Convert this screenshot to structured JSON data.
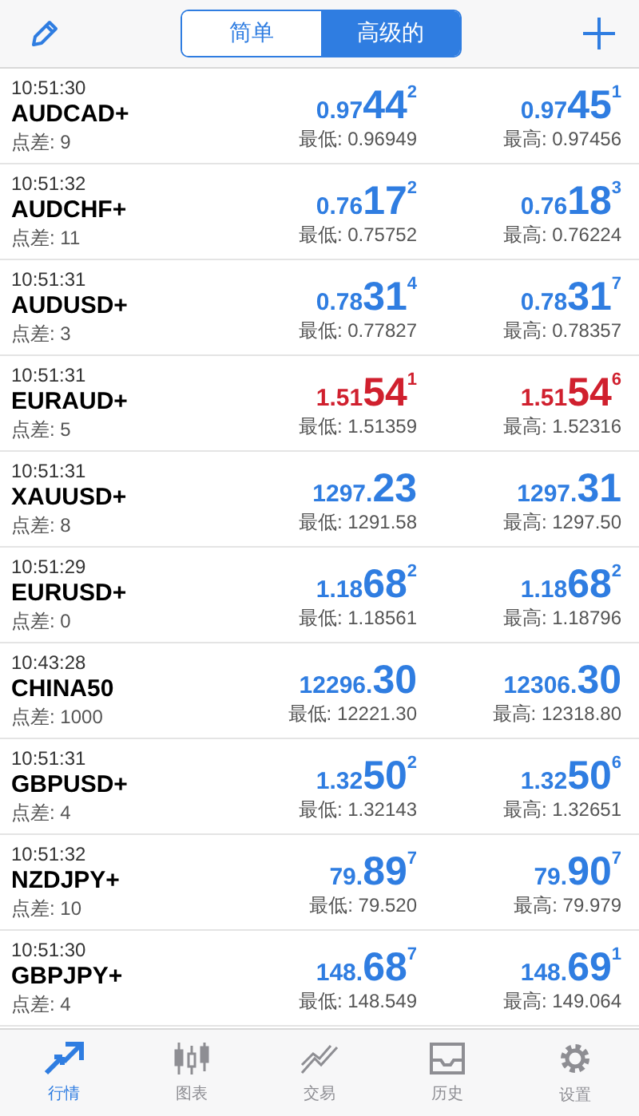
{
  "header": {
    "segments": [
      {
        "label": "简单",
        "selected": false
      },
      {
        "label": "高级的",
        "selected": true
      }
    ]
  },
  "quotes": [
    {
      "time": "10:51:30",
      "symbol": "AUDCAD+",
      "spread": "点差: 9",
      "bid": {
        "color": "#2f7de1",
        "small": "0.97",
        "big": "44",
        "sup": "2"
      },
      "ask": {
        "color": "#2f7de1",
        "small": "0.97",
        "big": "45",
        "sup": "1"
      },
      "low": "最低: 0.96949",
      "high": "最高: 0.97456"
    },
    {
      "time": "10:51:32",
      "symbol": "AUDCHF+",
      "spread": "点差: 11",
      "bid": {
        "color": "#2f7de1",
        "small": "0.76",
        "big": "17",
        "sup": "2"
      },
      "ask": {
        "color": "#2f7de1",
        "small": "0.76",
        "big": "18",
        "sup": "3"
      },
      "low": "最低: 0.75752",
      "high": "最高: 0.76224"
    },
    {
      "time": "10:51:31",
      "symbol": "AUDUSD+",
      "spread": "点差: 3",
      "bid": {
        "color": "#2f7de1",
        "small": "0.78",
        "big": "31",
        "sup": "4"
      },
      "ask": {
        "color": "#2f7de1",
        "small": "0.78",
        "big": "31",
        "sup": "7"
      },
      "low": "最低: 0.77827",
      "high": "最高: 0.78357"
    },
    {
      "time": "10:51:31",
      "symbol": "EURAUD+",
      "spread": "点差: 5",
      "bid": {
        "color": "#d0202e",
        "small": "1.51",
        "big": "54",
        "sup": "1"
      },
      "ask": {
        "color": "#d0202e",
        "small": "1.51",
        "big": "54",
        "sup": "6"
      },
      "low": "最低: 1.51359",
      "high": "最高: 1.52316"
    },
    {
      "time": "10:51:31",
      "symbol": "XAUUSD+",
      "spread": "点差: 8",
      "bid": {
        "color": "#2f7de1",
        "small": "1297.",
        "big": "23"
      },
      "ask": {
        "color": "#2f7de1",
        "small": "1297.",
        "big": "31"
      },
      "low": "最低: 1291.58",
      "high": "最高: 1297.50"
    },
    {
      "time": "10:51:29",
      "symbol": "EURUSD+",
      "spread": "点差: 0",
      "bid": {
        "color": "#2f7de1",
        "small": "1.18",
        "big": "68",
        "sup": "2"
      },
      "ask": {
        "color": "#2f7de1",
        "small": "1.18",
        "big": "68",
        "sup": "2"
      },
      "low": "最低: 1.18561",
      "high": "最高: 1.18796"
    },
    {
      "time": "10:43:28",
      "symbol": "CHINA50",
      "spread": "点差: 1000",
      "bid": {
        "color": "#2f7de1",
        "small": "12296.",
        "big": "30"
      },
      "ask": {
        "color": "#2f7de1",
        "small": "12306.",
        "big": "30"
      },
      "low": "最低: 12221.30",
      "high": "最高: 12318.80"
    },
    {
      "time": "10:51:31",
      "symbol": "GBPUSD+",
      "spread": "点差: 4",
      "bid": {
        "color": "#2f7de1",
        "small": "1.32",
        "big": "50",
        "sup": "2"
      },
      "ask": {
        "color": "#2f7de1",
        "small": "1.32",
        "big": "50",
        "sup": "6"
      },
      "low": "最低: 1.32143",
      "high": "最高: 1.32651"
    },
    {
      "time": "10:51:32",
      "symbol": "NZDJPY+",
      "spread": "点差: 10",
      "bid": {
        "color": "#2f7de1",
        "small": "79.",
        "big": "89",
        "sup": "7"
      },
      "ask": {
        "color": "#2f7de1",
        "small": "79.",
        "big": "90",
        "sup": "7"
      },
      "low": "最低: 79.520",
      "high": "最高: 79.979"
    },
    {
      "time": "10:51:30",
      "symbol": "GBPJPY+",
      "spread": "点差: 4",
      "bid": {
        "color": "#2f7de1",
        "small": "148.",
        "big": "68",
        "sup": "7"
      },
      "ask": {
        "color": "#2f7de1",
        "small": "148.",
        "big": "69",
        "sup": "1"
      },
      "low": "最低: 148.549",
      "high": "最高: 149.064"
    }
  ],
  "tab_bar": [
    {
      "kind": "quotes",
      "label": "行情",
      "selected": true
    },
    {
      "kind": "chart",
      "label": "图表",
      "selected": false
    },
    {
      "kind": "trade",
      "label": "交易",
      "selected": false
    },
    {
      "kind": "history",
      "label": "历史",
      "selected": false
    },
    {
      "kind": "settings",
      "label": "设置",
      "selected": false
    }
  ]
}
